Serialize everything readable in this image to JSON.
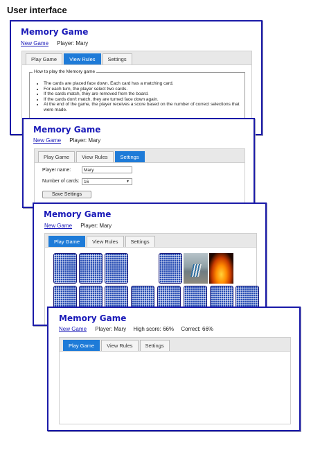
{
  "page_heading": "User interface",
  "app": {
    "title": "Memory Game",
    "new_game": "New Game"
  },
  "tabs": [
    "Play Game",
    "View Rules",
    "Settings"
  ],
  "panel1": {
    "player": "Player: Mary",
    "active_tab": "View Rules",
    "rules": {
      "legend": "How to play the Memory game",
      "items": [
        "The cards are placed face down. Each card has a matching card.",
        "For each turn, the player select two cards.",
        "If the cards match, they are removed from the board.",
        "If the cards don't match, they are turned face down again.",
        "At the end of the game, the player receives a score based on the number of correct selections that were made."
      ]
    }
  },
  "panel2": {
    "player": "Player: Mary",
    "active_tab": "Settings",
    "settings": {
      "player_name_label": "Player name:",
      "player_name_value": "Mary",
      "num_cards_label": "Number of cards:",
      "num_cards_value": "16",
      "save_label": "Save Settings"
    }
  },
  "panel3": {
    "player": "Player: Mary",
    "active_tab": "Play Game",
    "board": {
      "row1": [
        "back",
        "back",
        "back",
        "empty",
        "back",
        "beach-photo",
        "fire-photo"
      ],
      "row2": [
        "back",
        "back",
        "back",
        "back",
        "back",
        "back",
        "back",
        "back"
      ]
    }
  },
  "panel4": {
    "player": "Player: Mary",
    "high_score": "High score: 66%",
    "correct": "Correct: 66%",
    "active_tab": "Play Game"
  },
  "colors": {
    "accent": "#1a1ab8",
    "tab_active": "#1e7bd8",
    "card_back": "#2a4fb5"
  }
}
